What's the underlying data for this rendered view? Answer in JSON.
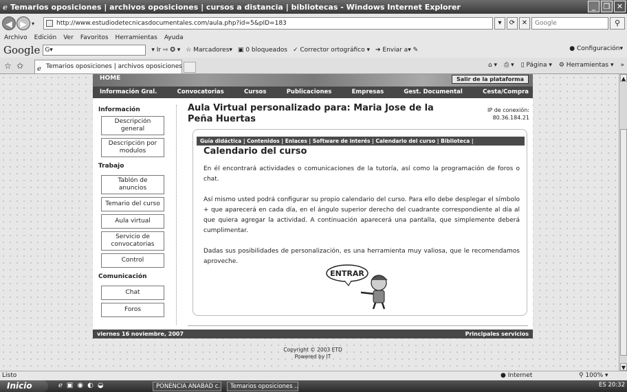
{
  "window": {
    "title": "Temarios oposiciones | archivos oposiciones | cursos a distancia | bibliotecas - Windows Internet Explorer"
  },
  "address_bar": {
    "url": "http://www.estudiodetecnicasdocumentales.com/aula.php?id=5&pID=183",
    "search_placeholder": "Google"
  },
  "menu": [
    "Archivo",
    "Edición",
    "Ver",
    "Favoritos",
    "Herramientas",
    "Ayuda"
  ],
  "google_toolbar": {
    "logo": "Google",
    "field_value": "G▾",
    "go_label": "Ir",
    "bookmarks": "Marcadores▾",
    "blocked": "0 bloqueados",
    "spell": "Corrector ortográfico ▾",
    "send": "Enviar a▾",
    "config": "Configuración▾"
  },
  "tab": {
    "label": "Temarios oposiciones | archivos oposiciones | cursos a..."
  },
  "command_bar": {
    "page": "Página ▾",
    "tools": "Herramientas ▾"
  },
  "site": {
    "banner_home": "HOME",
    "banner_salir": "Salir de la plataforma",
    "topnav": [
      "Información Gral.",
      "Convocatorias",
      "Cursos",
      "Publicaciones",
      "Empresas",
      "Gest. Documental",
      "Cesta/Compra"
    ],
    "sidebar": {
      "informacion_heading": "Información",
      "informacion_items": [
        "Descripción general",
        "Descripción por modulos"
      ],
      "trabajo_heading": "Trabajo",
      "trabajo_items": [
        "Tablón de anuncios",
        "Temario del curso",
        "Aula virtual",
        "Servicio de convocatorias",
        "Control"
      ],
      "comunicacion_heading": "Comunicación",
      "comunicacion_items": [
        "Chat",
        "Foros"
      ]
    },
    "heading": "Aula Virtual personalizado para: Maria Jose de la Peña Huertas",
    "ip_label": "IP de conexión:",
    "ip_value": "80.36.184.21",
    "subnav": "Guía didáctica |   Contenidos |   Enlaces |   Software de interés |   Calendario del curso |   Biblioteca |",
    "panel_title": "Calendario del curso",
    "paragraphs": [
      "En él encontrará actividades o comunicaciones de la tutoría, así como la programación de foros o chat.",
      "Así mismo usted podrá configurar su propio calendario del curso. Para ello debe desplegar el símbolo + que aparecerá en cada día, en el ángulo superior derecho del cuadrante correspondiente al día al que quiera agregar la actividad. A continuación aparecerá una pantalla, que simplemente deberá cumplimentar.",
      "Dadas sus posibilidades de personalización, es una herramienta muy valiosa, que le recomendamos aproveche."
    ],
    "entrar_label": "ENTRAR",
    "footer_date": "viernes 16 noviembre, 2007",
    "footer_link": "Principales servicios",
    "copyright_line1": "Copyright © 2003 ETD",
    "copyright_line2": "Powered by IT"
  },
  "status": {
    "left": "Listo",
    "zone": "Internet",
    "zoom": "100%"
  },
  "taskbar": {
    "start": "Inicio",
    "tasks": [
      "PONENCIA ANABAD c...",
      "Temarios oposiciones ..."
    ],
    "tray": "ES  20:32"
  }
}
